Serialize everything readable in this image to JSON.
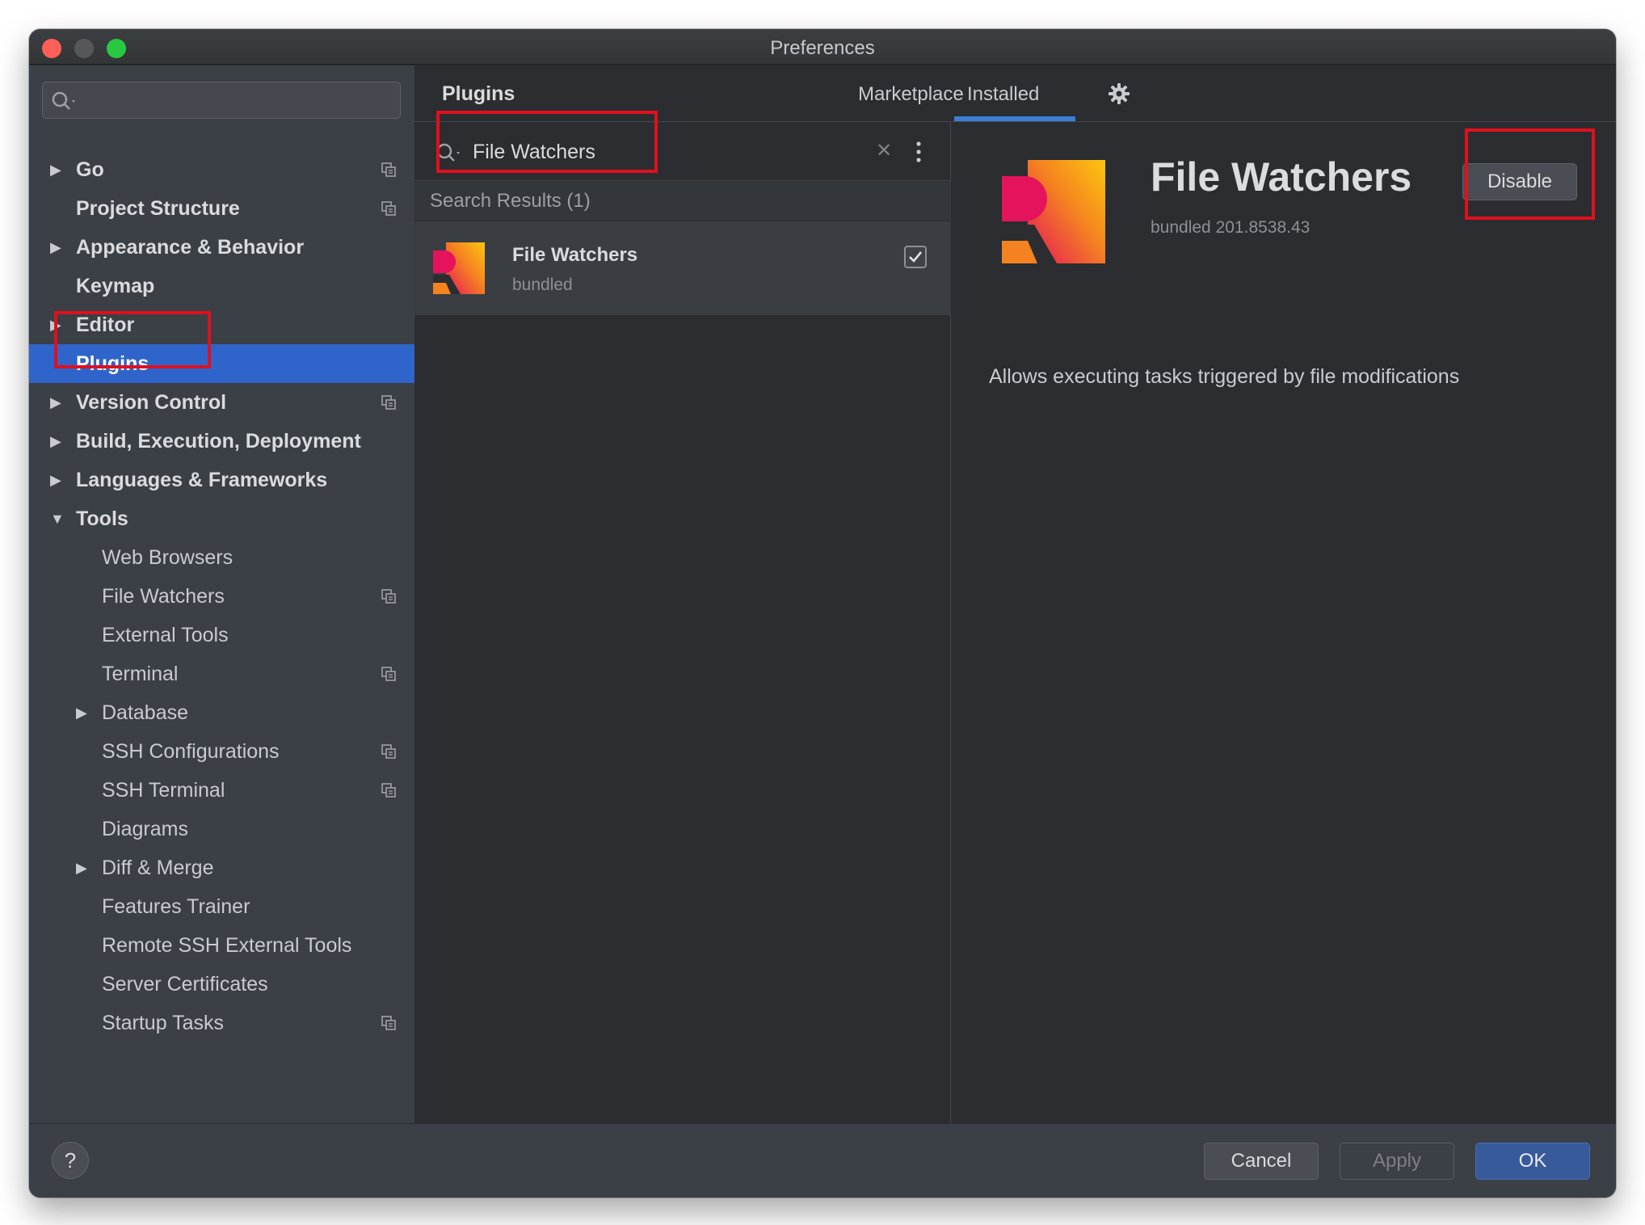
{
  "window": {
    "title": "Preferences"
  },
  "sidebar": {
    "search_placeholder": "",
    "items": [
      {
        "label": "Go",
        "level": 0,
        "arrow": "▶",
        "project_icon": true
      },
      {
        "label": "Project Structure",
        "level": 0,
        "arrow": "",
        "project_icon": true
      },
      {
        "label": "Appearance & Behavior",
        "level": 0,
        "arrow": "▶",
        "project_icon": false
      },
      {
        "label": "Keymap",
        "level": 0,
        "arrow": "",
        "project_icon": false
      },
      {
        "label": "Editor",
        "level": 0,
        "arrow": "▶",
        "project_icon": false
      },
      {
        "label": "Plugins",
        "level": 0,
        "arrow": "",
        "project_icon": false,
        "selected": true
      },
      {
        "label": "Version Control",
        "level": 0,
        "arrow": "▶",
        "project_icon": true
      },
      {
        "label": "Build, Execution, Deployment",
        "level": 0,
        "arrow": "▶",
        "project_icon": false
      },
      {
        "label": "Languages & Frameworks",
        "level": 0,
        "arrow": "▶",
        "project_icon": false
      },
      {
        "label": "Tools",
        "level": 0,
        "arrow": "▼",
        "project_icon": false
      },
      {
        "label": "Web Browsers",
        "level": 1,
        "arrow": "",
        "project_icon": false
      },
      {
        "label": "File Watchers",
        "level": 1,
        "arrow": "",
        "project_icon": true
      },
      {
        "label": "External Tools",
        "level": 1,
        "arrow": "",
        "project_icon": false
      },
      {
        "label": "Terminal",
        "level": 1,
        "arrow": "",
        "project_icon": true
      },
      {
        "label": "Database",
        "level": 1,
        "arrow": "▶",
        "project_icon": false
      },
      {
        "label": "SSH Configurations",
        "level": 1,
        "arrow": "",
        "project_icon": true
      },
      {
        "label": "SSH Terminal",
        "level": 1,
        "arrow": "",
        "project_icon": true
      },
      {
        "label": "Diagrams",
        "level": 1,
        "arrow": "",
        "project_icon": false
      },
      {
        "label": "Diff & Merge",
        "level": 1,
        "arrow": "▶",
        "project_icon": false
      },
      {
        "label": "Features Trainer",
        "level": 1,
        "arrow": "",
        "project_icon": false
      },
      {
        "label": "Remote SSH External Tools",
        "level": 1,
        "arrow": "",
        "project_icon": false
      },
      {
        "label": "Server Certificates",
        "level": 1,
        "arrow": "",
        "project_icon": false
      },
      {
        "label": "Startup Tasks",
        "level": 1,
        "arrow": "",
        "project_icon": true
      }
    ]
  },
  "header": {
    "title": "Plugins",
    "tabs": [
      {
        "label": "Marketplace"
      },
      {
        "label": "Installed",
        "active": true
      }
    ],
    "settings_icon": "gear-icon"
  },
  "search": {
    "value": "File Watchers",
    "results_label": "Search Results (1)"
  },
  "results": [
    {
      "name": "File Watchers",
      "sub": "bundled",
      "enabled": true
    }
  ],
  "detail": {
    "name": "File Watchers",
    "version": "bundled 201.8538.43",
    "description": "Allows executing tasks triggered by file modifications",
    "disable_label": "Disable"
  },
  "footer": {
    "help_label": "?",
    "cancel_label": "Cancel",
    "apply_label": "Apply",
    "ok_label": "OK"
  },
  "colors": {
    "accent": "#2f65ca",
    "annotation": "#e0101e",
    "logo_pink": "#e5135b",
    "logo_orange": "#f58220",
    "logo_yellow": "#fdc60f"
  }
}
